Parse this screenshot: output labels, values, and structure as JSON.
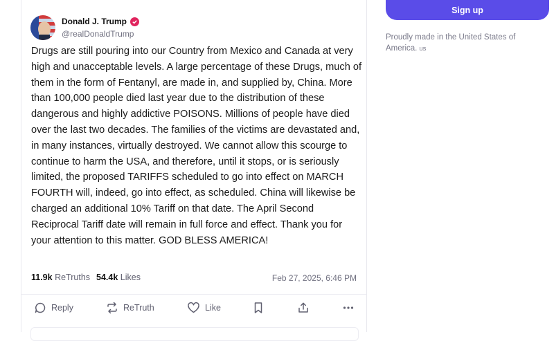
{
  "post": {
    "author_name": "Donald J. Trump",
    "handle": "@realDonaldTrump",
    "text": "Drugs are still pouring into our Country from Mexico and Canada at very high and unacceptable levels. A large percentage of these Drugs, much of them in the form of Fentanyl, are made in, and supplied by, China. More than 100,000 people died last year due to the distribution of these dangerous and highly addictive POISONS. Millions of people have died over the last two decades. The families of the victims are devastated and, in many instances, virtually destroyed. We cannot allow this scourge to continue to harm the USA, and therefore, until it stops, or is seriously limited, the proposed TARIFFS scheduled to go into effect on MARCH FOURTH will, indeed, go into effect, as scheduled. China will likewise be charged an additional 10% Tariff on that date. The April Second Reciprocal Tariff date will remain in full force and effect. Thank you for your attention to this matter. GOD BLESS AMERICA!",
    "retruths_count": "11.9k",
    "retruths_label": "ReTruths",
    "likes_count": "54.4k",
    "likes_label": "Likes",
    "timestamp": "Feb 27, 2025, 6:46 PM"
  },
  "actions": {
    "reply": "Reply",
    "retruth": "ReTruth",
    "like": "Like"
  },
  "sidebar": {
    "signup_label": "Sign up",
    "made_in_text": "Proudly made in the United States of America.",
    "country_code": "us"
  },
  "icons": {
    "verified": "verified-badge-icon",
    "reply": "speech-bubble-icon",
    "retruth": "retruth-arrows-icon",
    "like": "heart-icon",
    "bookmark": "bookmark-icon",
    "share": "share-upload-icon",
    "more": "more-dots-icon"
  },
  "colors": {
    "accent": "#5a4ce8",
    "verified": "#e0245e",
    "muted_text": "#707080"
  }
}
